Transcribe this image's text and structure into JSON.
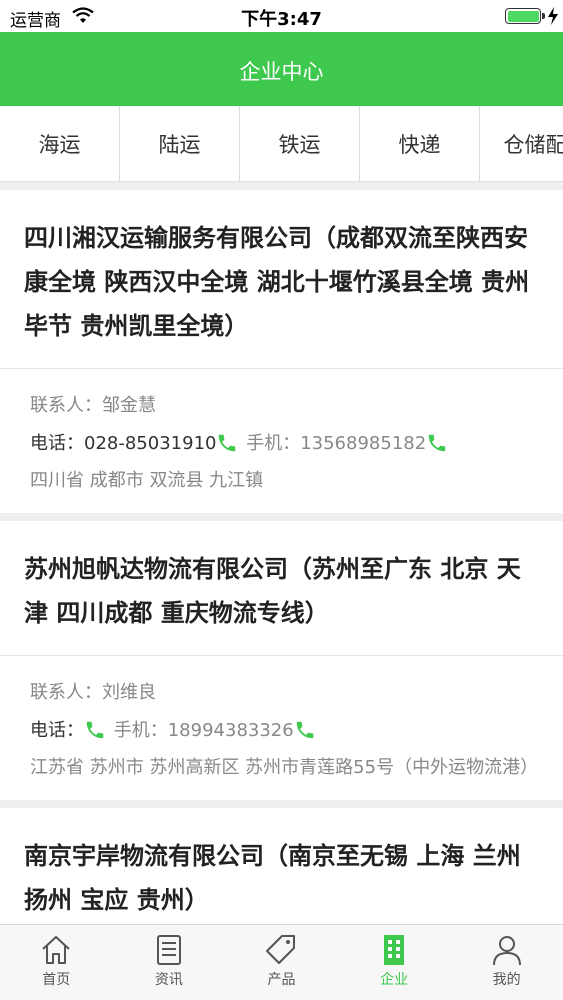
{
  "status_bar": {
    "carrier": "运营商",
    "time": "下午3:47"
  },
  "nav": {
    "title": "企业中心"
  },
  "tabs": [
    {
      "label": "海运"
    },
    {
      "label": "陆运"
    },
    {
      "label": "铁运"
    },
    {
      "label": "快递"
    },
    {
      "label": "仓储配"
    }
  ],
  "companies": [
    {
      "name": "四川湘汉运输服务有限公司（成都双流至陕西安康全境 陕西汉中全境 湖北十堰竹溪县全境 贵州毕节 贵州凯里全境）",
      "contact_label": "联系人：",
      "contact": "邹金慧",
      "phone_label": "电话：",
      "phone": "028-85031910",
      "mobile_label": "手机：",
      "mobile": "13568985182",
      "address": "四川省 成都市 双流县 九江镇"
    },
    {
      "name": "苏州旭帆达物流有限公司（苏州至广东 北京 天津 四川成都 重庆物流专线）",
      "contact_label": "联系人：",
      "contact": "刘维良",
      "phone_label": "电话：",
      "phone": "",
      "mobile_label": "手机：",
      "mobile": "18994383326",
      "address": "江苏省 苏州市 苏州高新区 苏州市青莲路55号（中外运物流港）"
    },
    {
      "name": "南京宇岸物流有限公司（南京至无锡 上海 兰州 扬州 宝应 贵州）"
    }
  ],
  "tabbar": [
    {
      "label": "首页",
      "icon": "home-icon"
    },
    {
      "label": "资讯",
      "icon": "news-icon"
    },
    {
      "label": "产品",
      "icon": "tag-icon"
    },
    {
      "label": "企业",
      "icon": "building-icon",
      "active": true
    },
    {
      "label": "我的",
      "icon": "person-icon"
    }
  ],
  "colors": {
    "accent": "#3fc84e",
    "phone_icon": "#3fc84e"
  }
}
